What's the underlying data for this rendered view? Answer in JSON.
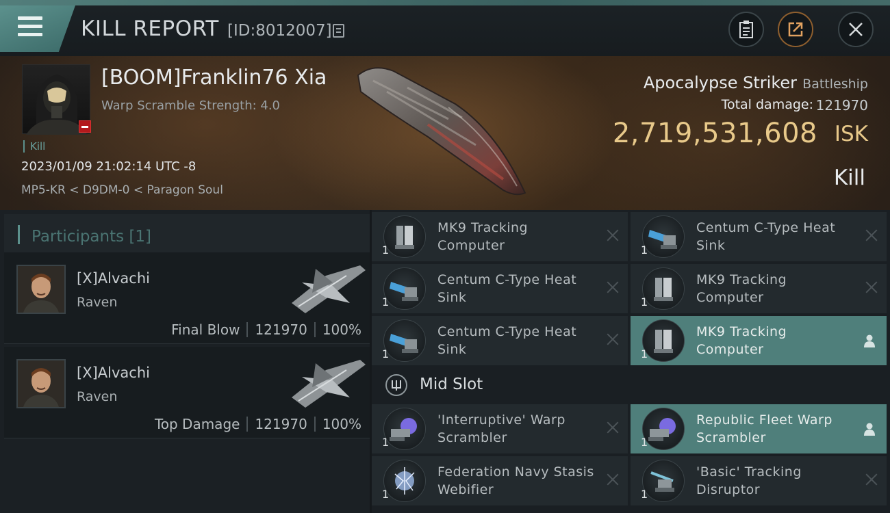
{
  "header": {
    "title": "KILL REPORT",
    "report_id": "[ID:8012007]"
  },
  "victim": {
    "name": "[BOOM]Franklin76 Xia",
    "warp_scramble": "Warp Scramble Strength: 4.0",
    "kill_tag": "Kill",
    "datetime": "2023/01/09 21:02:14 UTC -8",
    "location": "MP5-KR < D9DM-0 < Paragon Soul",
    "ship_name": "Apocalypse Striker",
    "ship_class": "Battleship",
    "total_damage_label": "Total damage:",
    "total_damage_value": "121970",
    "isk_value": "2,719,531,608",
    "isk_unit": "ISK",
    "result": "Kill"
  },
  "participants": {
    "title": "Participants [1]",
    "list": [
      {
        "name": "[X]Alvachi",
        "ship": "Raven",
        "role": "Final Blow",
        "damage": "121970",
        "percent": "100%"
      },
      {
        "name": "[X]Alvachi",
        "ship": "Raven",
        "role": "Top Damage",
        "damage": "121970",
        "percent": "100%"
      }
    ]
  },
  "items": {
    "low": [
      {
        "name": "MK9 Tracking Computer",
        "qty": "1",
        "icon": "tracking-computer-icon",
        "status": "destroyed"
      },
      {
        "name": "Centum C-Type Heat Sink",
        "qty": "1",
        "icon": "heat-sink-icon",
        "status": "destroyed"
      },
      {
        "name": "Centum C-Type Heat Sink",
        "qty": "1",
        "icon": "heat-sink-icon",
        "status": "destroyed"
      },
      {
        "name": "MK9 Tracking Computer",
        "qty": "1",
        "icon": "tracking-computer-icon",
        "status": "destroyed"
      },
      {
        "name": "Centum C-Type Heat Sink",
        "qty": "1",
        "icon": "heat-sink-icon",
        "status": "destroyed"
      },
      {
        "name": "MK9 Tracking Computer",
        "qty": "1",
        "icon": "tracking-computer-icon",
        "status": "dropped"
      }
    ],
    "mid_slot_label": "Mid Slot",
    "mid": [
      {
        "name": "'Interruptive' Warp Scrambler",
        "qty": "1",
        "icon": "warp-scrambler-icon",
        "status": "destroyed"
      },
      {
        "name": "Republic Fleet Warp Scrambler",
        "qty": "1",
        "icon": "warp-scrambler-icon",
        "status": "dropped"
      },
      {
        "name": "Federation Navy Stasis Webifier",
        "qty": "1",
        "icon": "stasis-webifier-icon",
        "status": "destroyed"
      },
      {
        "name": "'Basic' Tracking Disruptor",
        "qty": "1",
        "icon": "tracking-disruptor-icon",
        "status": "destroyed"
      }
    ]
  },
  "colors": {
    "accent": "#5c918d",
    "isk": "#e8c98a",
    "highlight_row": "#4f7f7b",
    "kill_badge": "#b3191c"
  }
}
